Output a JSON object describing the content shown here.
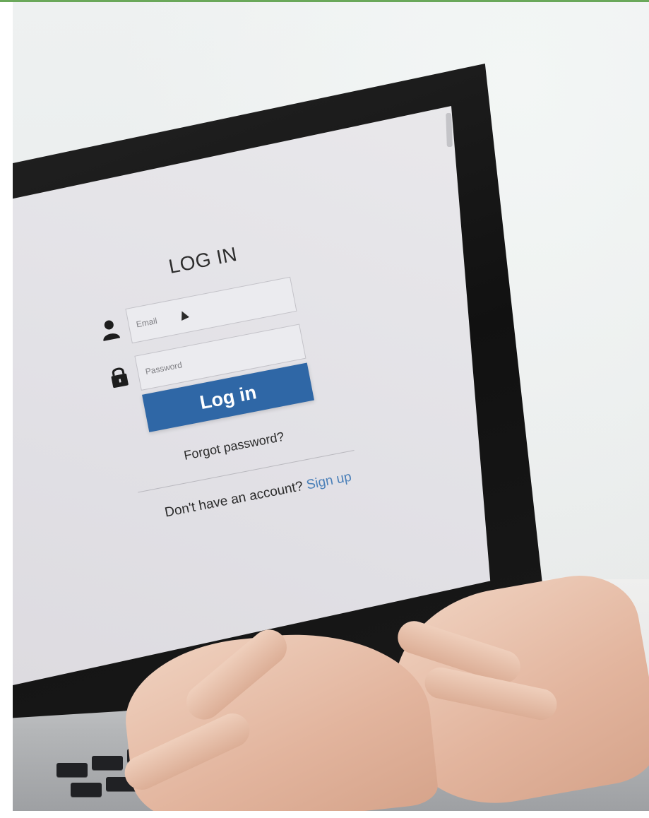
{
  "login": {
    "title": "LOG IN",
    "email_placeholder": "Email",
    "password_placeholder": "Password",
    "login_button": "Log in",
    "forgot_password": "Forgot password?",
    "signup_prompt": "Don't have an account?",
    "signup_link": "Sign up"
  },
  "icons": {
    "email_icon": "user-icon",
    "password_icon": "lock-icon"
  },
  "colors": {
    "button": "#2f67a6",
    "link": "#4a7fb8",
    "top_rule": "#6aa85a"
  }
}
